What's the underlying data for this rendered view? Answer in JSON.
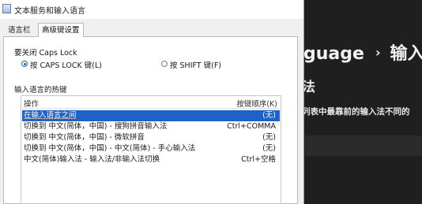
{
  "background_window": {
    "breadcrumb_left": "guage",
    "breadcrumb_right": "输入",
    "subheading": "法",
    "description": "列表中最靠前的输入法不同的"
  },
  "dialog": {
    "title": "文本服务和输入语言",
    "tabs": [
      {
        "label": "语言栏"
      },
      {
        "label": "高级键设置"
      }
    ],
    "caps_lock": {
      "heading": "要关闭 Caps Lock",
      "options": [
        {
          "label": "按 CAPS LOCK 键(L)",
          "selected": true
        },
        {
          "label": "按 SHIFT 键(F)",
          "selected": false
        }
      ]
    },
    "hotkeys": {
      "heading": "输入语言的热键",
      "columns": {
        "action": "操作",
        "key_sequence": "按键顺序(K)"
      },
      "rows": [
        {
          "action": "在输入语言之间",
          "keys": "(无)",
          "selected": true
        },
        {
          "action": "切换到 中文(简体，中国) - 搜狗拼音输入法",
          "keys": "Ctrl+COMMA",
          "selected": false
        },
        {
          "action": "切换到 中文(简体，中国) - 微软拼音",
          "keys": "(无)",
          "selected": false
        },
        {
          "action": "切换到 中文(简体，中国) - 中文(简体) - 手心输入法",
          "keys": "(无)",
          "selected": false
        },
        {
          "action": "中文(简体)输入法 - 输入法/非输入法切换",
          "keys": "Ctrl+空格",
          "selected": false
        }
      ]
    }
  },
  "colors": {
    "selection": "#1e62c8",
    "background_dark": "#1f1f1f"
  }
}
